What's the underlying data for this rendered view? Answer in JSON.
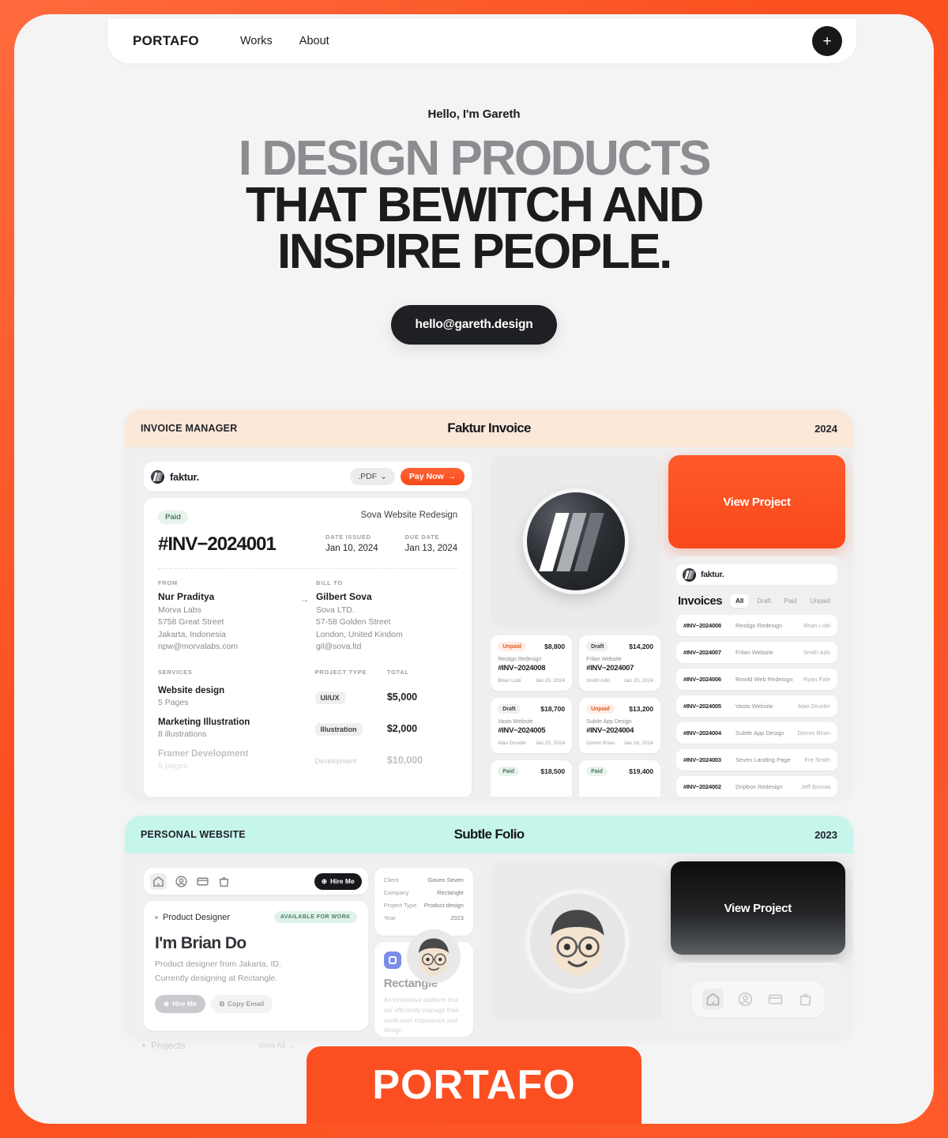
{
  "nav": {
    "brand": "PORTAFO",
    "links": [
      "Works",
      "About"
    ],
    "plus": "+"
  },
  "hero": {
    "greeting": "Hello, I'm Gareth",
    "line1": "I DESIGN PRODUCTS",
    "line2": "THAT BEWITCH AND",
    "line3": "INSPIRE PEOPLE.",
    "cta": "hello@gareth.design"
  },
  "projects": [
    {
      "category": "INVOICE MANAGER",
      "name": "Faktur Invoice",
      "year": "2024",
      "view_label": "View Project",
      "app": {
        "brand": "faktur.",
        "pdf_label": ".PDF",
        "pay_label": "Pay Now",
        "status": "Paid",
        "project_title": "Sova Website Redesign",
        "invoice_no": "#INV−2024001",
        "date_issued_label": "DATE ISSUED",
        "date_issued": "Jan 10, 2024",
        "due_date_label": "DUE DATE",
        "due_date": "Jan 13, 2024",
        "from_label": "FROM",
        "bill_to_label": "BILL TO",
        "from": {
          "name": "Nur Praditya",
          "lines": [
            "Morva Labs",
            "5758 Great Street",
            "Jakarta, Indonesia",
            "npw@morvalabs.com"
          ]
        },
        "bill_to": {
          "name": "Gilbert Sova",
          "lines": [
            "Sova LTD.",
            "57-58 Golden Street",
            "London, United Kindom",
            "gil@sova.ltd"
          ]
        },
        "table_headers": [
          "SERVICES",
          "PROJECT TYPE",
          "TOTAL"
        ],
        "services": [
          {
            "title": "Website design",
            "sub": "5 Pages",
            "type": "UI/UX",
            "total": "$5,000"
          },
          {
            "title": "Marketing Illustration",
            "sub": "8 illustrations",
            "type": "Illustration",
            "total": "$2,000"
          },
          {
            "title": "Framer Development",
            "sub": "5 pages",
            "type": "Development",
            "total": "$10,000"
          }
        ]
      },
      "mini_cards": [
        {
          "status": "Unpaid",
          "amount": "$8,800",
          "title": "Restigo Redesign",
          "no": "#INV−2024008",
          "client": "Brian Lobi",
          "date": "Jan 20, 2024"
        },
        {
          "status": "Draft",
          "amount": "$14,200",
          "title": "Frilan Website",
          "no": "#INV−2024007",
          "client": "Smith Ado",
          "date": "Jan 20, 2024"
        },
        {
          "status": "Draft",
          "amount": "$18,700",
          "title": "Vasto Website",
          "no": "#INV−2024005",
          "client": "Alan Druxler",
          "date": "Jan 20, 2024"
        },
        {
          "status": "Unpaid",
          "amount": "$13,200",
          "title": "Subtle App Design",
          "no": "#INV−2024004",
          "client": "Domm Brian",
          "date": "Jan 16, 2024"
        },
        {
          "status": "Paid",
          "amount": "$18,500",
          "title": "",
          "no": "",
          "client": "",
          "date": ""
        },
        {
          "status": "Paid",
          "amount": "$19,400",
          "title": "",
          "no": "",
          "client": "",
          "date": ""
        }
      ],
      "list": {
        "brand": "faktur.",
        "title": "Invoices",
        "tabs": [
          "All",
          "Draft",
          "Paid",
          "Unpaid"
        ],
        "active_tab": "All",
        "rows": [
          {
            "no": "#INV−2024008",
            "name": "Restigo Redesign",
            "client": "Brian Lobi"
          },
          {
            "no": "#INV−2024007",
            "name": "Frilan Website",
            "client": "Smith Ado"
          },
          {
            "no": "#INV−2024006",
            "name": "Rinold Web Redesign",
            "client": "Ryan Fale"
          },
          {
            "no": "#INV−2024005",
            "name": "Vasto Website",
            "client": "Alan Druxler"
          },
          {
            "no": "#INV−2024004",
            "name": "Subtle App Design",
            "client": "Domm Brian"
          },
          {
            "no": "#INV−2024003",
            "name": "Seven Landing Page",
            "client": "Fre Smith"
          },
          {
            "no": "#INV−2024002",
            "name": "Dripbox Redesign",
            "client": "Jeff Bosnia"
          }
        ]
      }
    },
    {
      "category": "PERSONAL WEBSITE",
      "name": "Subtle Folio",
      "year": "2023",
      "view_label": "View Project",
      "site": {
        "hire_label": "Hire Me",
        "role": "Product Designer",
        "available": "AVAILABLE FOR WORK",
        "name": "I'm Brian Do",
        "desc_line1": "Product designer from Jakarta, ID.",
        "desc_line2": "Currently designing at Rectangle.",
        "btn_hire": "Hire Me",
        "btn_copy": "Copy Email",
        "meta": [
          {
            "k": "Client",
            "v": "Gaven Seven"
          },
          {
            "k": "Company",
            "v": "Rectangle"
          },
          {
            "k": "Project Type",
            "v": "Product design"
          },
          {
            "k": "Year",
            "v": "2023"
          }
        ],
        "rect_title": "Rectangle",
        "rect_desc": "An innovative platform that ser efficiently manage their worki user experience and design"
      }
    }
  ],
  "footer_fade": {
    "projects_label": "Projects",
    "view_all_label": "View All  →"
  },
  "badge": {
    "text": "PORTAFO"
  },
  "colors": {
    "orange": "#FB4F22",
    "cream": "#FBE8D8",
    "mint": "#C6F5EC",
    "dark": "#17191C"
  }
}
